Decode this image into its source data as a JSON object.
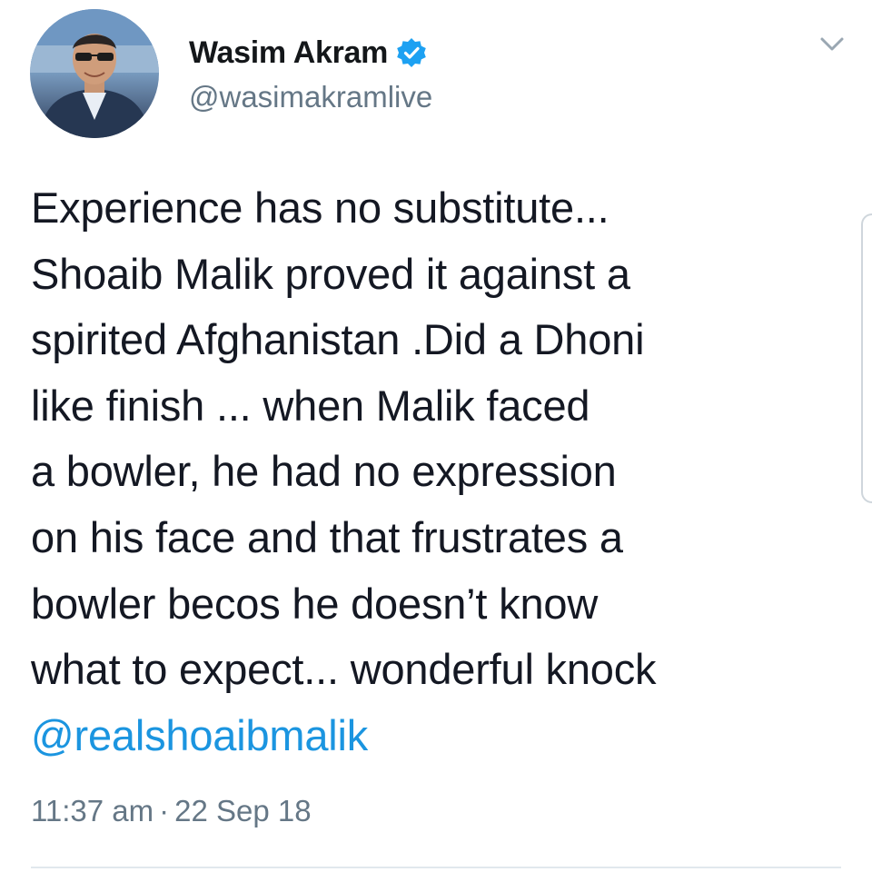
{
  "author": {
    "display_name": "Wasim Akram",
    "handle": "@wasimakramlive",
    "verified": true,
    "avatar_icon": "profile-photo"
  },
  "tweet": {
    "lines": [
      "Experience has no substitute...",
      "Shoaib Malik proved it against a",
      "spirited Afghanistan .Did a Dhoni",
      "like finish ... when Malik faced",
      "a bowler, he had no expression",
      "on his face and that frustrates a",
      "bowler becos he doesn’t know",
      "what to expect... wonderful knock"
    ],
    "mention": "@realshoaibmalik",
    "time": "11:37 am",
    "separator": "·",
    "date": "22 Sep 18"
  },
  "icons": {
    "verified": "verified-badge-icon",
    "menu": "chevron-down-icon"
  },
  "colors": {
    "text": "#141823",
    "secondary": "#657786",
    "link": "#1b95e0",
    "verified": "#1da1f2",
    "divider": "#e1e8ed"
  }
}
